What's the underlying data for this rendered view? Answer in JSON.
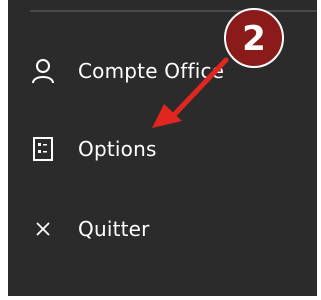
{
  "menu": {
    "items": [
      {
        "label": "Compte Office",
        "icon": "person-icon"
      },
      {
        "label": "Options",
        "icon": "options-icon"
      },
      {
        "label": "Quitter",
        "icon": "close-icon"
      }
    ]
  },
  "annotation": {
    "step_number": "2",
    "badge_color": "#8b1a1a",
    "arrow_color": "#e0261e"
  },
  "colors": {
    "panel_bg": "#2b2b2b",
    "text": "#ffffff"
  }
}
